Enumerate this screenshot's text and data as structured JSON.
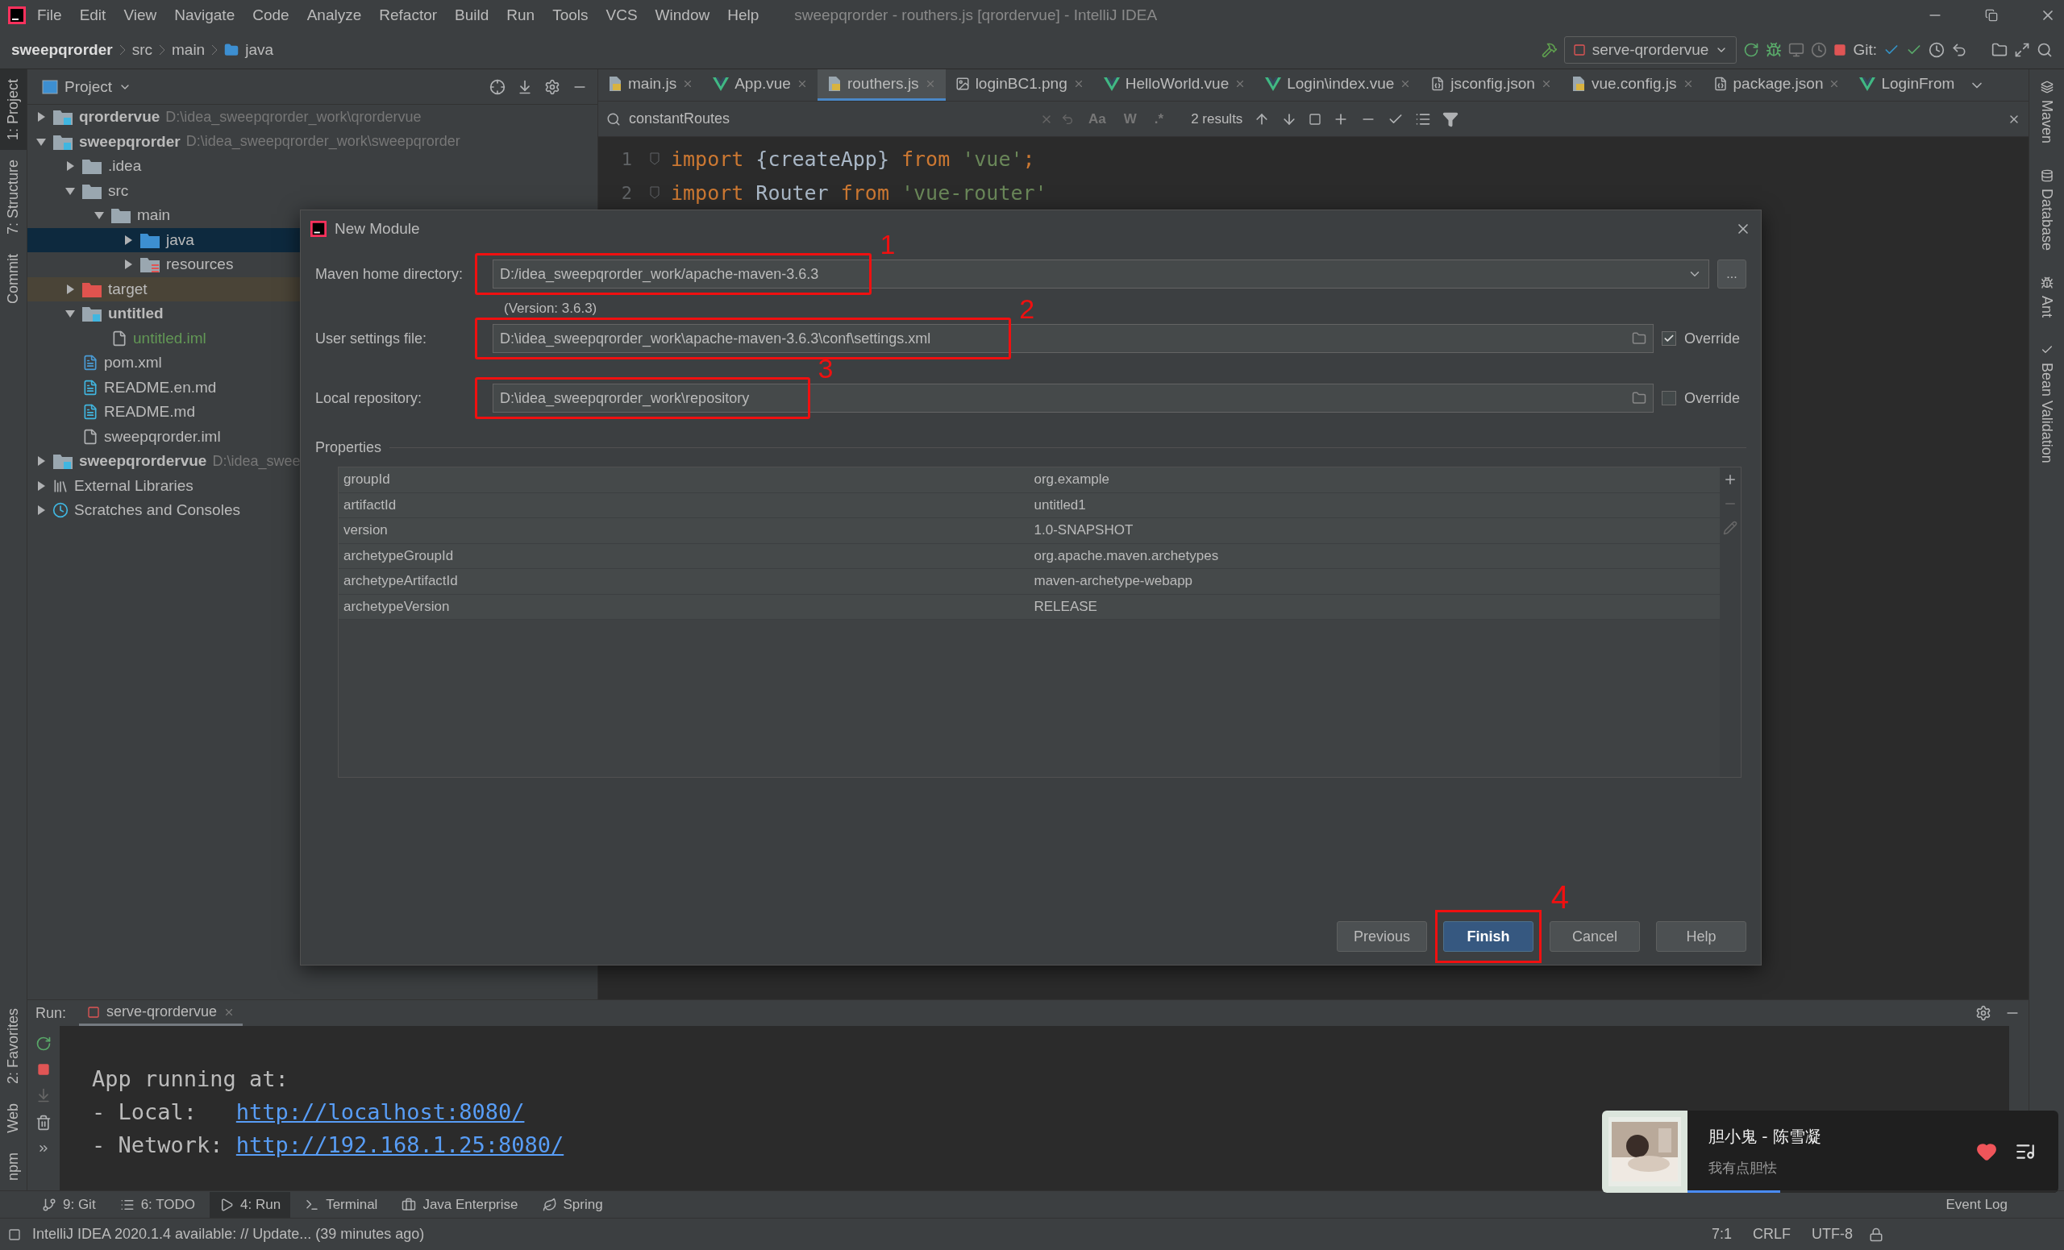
{
  "menu_bar": {
    "items": [
      "File",
      "Edit",
      "View",
      "Navigate",
      "Code",
      "Analyze",
      "Refactor",
      "Build",
      "Run",
      "Tools",
      "VCS",
      "Window",
      "Help"
    ],
    "title": "sweepqrorder - routhers.js [qrordervue] - IntelliJ IDEA"
  },
  "breadcrumbs": [
    "sweepqrorder",
    "src",
    "main",
    "java"
  ],
  "toolbar": {
    "run_config": "serve-qrordervue",
    "git_label": "Git:"
  },
  "left_strip": [
    {
      "label": "1: Project",
      "selected": true
    },
    {
      "label": "7: Structure",
      "selected": false
    },
    {
      "label": "Commit",
      "selected": false
    }
  ],
  "left_strip_bottom": [
    "2: Favorites",
    "Web",
    "npm"
  ],
  "right_strip": [
    "Maven",
    "Database",
    "Ant",
    "Bean Validation"
  ],
  "project_panel": {
    "title": "Project",
    "tree": [
      {
        "name": "qrordervue",
        "path": "D:\\idea_sweepqrorder_work\\qrordervue",
        "kind": "module",
        "expanded": false,
        "selected": false
      },
      {
        "name": "sweepqrorder",
        "path": "D:\\idea_sweepqrorder_work\\sweepqrorder",
        "kind": "module",
        "expanded": true,
        "selected": false,
        "children": [
          {
            "name": ".idea",
            "kind": "folder",
            "expanded": false,
            "selected": false
          },
          {
            "name": "src",
            "kind": "folder",
            "expanded": true,
            "selected": false,
            "children": [
              {
                "name": "main",
                "kind": "folder",
                "expanded": true,
                "selected": false,
                "children": [
                  {
                    "name": "java",
                    "kind": "source-folder",
                    "expanded": false,
                    "selected": true
                  },
                  {
                    "name": "resources",
                    "kind": "resources-folder",
                    "expanded": false,
                    "selected": false
                  }
                ]
              }
            ]
          },
          {
            "name": "target",
            "kind": "excluded-folder",
            "expanded": false,
            "selected": false
          },
          {
            "name": "untitled",
            "kind": "module",
            "expanded": true,
            "selected": false,
            "children": [
              {
                "name": "untitled.iml",
                "kind": "iml",
                "selected": false,
                "added": true
              }
            ]
          },
          {
            "name": "pom.xml",
            "kind": "maven",
            "selected": false
          },
          {
            "name": "README.en.md",
            "kind": "markdown",
            "selected": false
          },
          {
            "name": "README.md",
            "kind": "markdown",
            "selected": false
          },
          {
            "name": "sweepqrorder.iml",
            "kind": "iml",
            "selected": false
          }
        ]
      },
      {
        "name": "sweepqrordervue",
        "path": "D:\\idea_swee",
        "kind": "module",
        "expanded": false,
        "selected": false
      },
      {
        "name": "External Libraries",
        "kind": "libraries",
        "expanded": false,
        "selected": false
      },
      {
        "name": "Scratches and Consoles",
        "kind": "scratches",
        "expanded": false,
        "selected": false
      }
    ]
  },
  "editor": {
    "tabs": [
      {
        "label": "main.js",
        "kind": "js",
        "selected": false
      },
      {
        "label": "App.vue",
        "kind": "vue",
        "selected": false
      },
      {
        "label": "routhers.js",
        "kind": "js",
        "selected": true
      },
      {
        "label": "loginBC1.png",
        "kind": "png",
        "selected": false
      },
      {
        "label": "HelloWorld.vue",
        "kind": "vue",
        "selected": false
      },
      {
        "label": "Login\\index.vue",
        "kind": "vue",
        "selected": false
      },
      {
        "label": "jsconfig.json",
        "kind": "json",
        "selected": false
      },
      {
        "label": "vue.config.js",
        "kind": "js",
        "selected": false
      },
      {
        "label": "package.json",
        "kind": "json",
        "selected": false
      },
      {
        "label": "LoginFrom",
        "kind": "vue",
        "selected": false
      }
    ],
    "find": {
      "query": "constantRoutes",
      "toggles": [
        "Aa",
        "W",
        ".*"
      ],
      "results": "2 results"
    },
    "lines": [
      {
        "number": "1",
        "tokens": [
          {
            "kind": "keyword",
            "text": "import"
          },
          {
            "kind": "plain",
            "text": " {createApp} "
          },
          {
            "kind": "keyword",
            "text": "from"
          },
          {
            "kind": "string",
            "text": " 'vue'"
          },
          {
            "kind": "keyword",
            "text": ";"
          }
        ]
      },
      {
        "number": "2",
        "tokens": [
          {
            "kind": "keyword",
            "text": "import"
          },
          {
            "kind": "plain",
            "text": " Router "
          },
          {
            "kind": "keyword",
            "text": "from"
          },
          {
            "kind": "string",
            "text": " 'vue-router'"
          }
        ]
      }
    ]
  },
  "dialog": {
    "title": "New Module",
    "fields": [
      {
        "label": "Maven home directory:",
        "value": "D:/idea_sweepqrorder_work/apache-maven-3.6.3",
        "kind": "dropdown",
        "annotation": "1"
      },
      {
        "label": "User settings file:",
        "value": "D:\\idea_sweepqrorder_work\\apache-maven-3.6.3\\conf\\settings.xml",
        "kind": "file",
        "override_label": "Override",
        "override": true,
        "annotation": "2"
      },
      {
        "label": "Local repository:",
        "value": "D:\\idea_sweepqrorder_work\\repository",
        "kind": "file",
        "override_label": "Override",
        "override": false,
        "annotation": "3"
      }
    ],
    "version_note": "(Version: 3.6.3)",
    "browse_button": "...",
    "properties_label": "Properties",
    "properties": [
      {
        "key": "groupId",
        "value": "org.example"
      },
      {
        "key": "artifactId",
        "value": "untitled1"
      },
      {
        "key": "version",
        "value": "1.0-SNAPSHOT"
      },
      {
        "key": "archetypeGroupId",
        "value": "org.apache.maven.archetypes"
      },
      {
        "key": "archetypeArtifactId",
        "value": "maven-archetype-webapp"
      },
      {
        "key": "archetypeVersion",
        "value": "RELEASE"
      }
    ],
    "buttons": [
      {
        "label": "Previous",
        "kind": "normal"
      },
      {
        "label": "Finish",
        "kind": "default",
        "annotation": "4"
      },
      {
        "label": "Cancel",
        "kind": "normal"
      },
      {
        "label": "Help",
        "kind": "normal"
      }
    ]
  },
  "run_panel": {
    "label": "Run:",
    "tab": "serve-qrordervue",
    "console": [
      {
        "text": "App running at:"
      },
      {
        "text": "- Local:   ",
        "link": "http://localhost:8080/"
      },
      {
        "text": "- Network: ",
        "link": "http://192.168.1.25:8080/"
      }
    ]
  },
  "tool_tabs": [
    {
      "label": "9: Git",
      "kind": "git",
      "selected": false
    },
    {
      "label": "6: TODO",
      "kind": "todo",
      "selected": false
    },
    {
      "label": "4: Run",
      "kind": "run",
      "selected": true
    },
    {
      "label": "Terminal",
      "kind": "terminal",
      "selected": false
    },
    {
      "label": "Java Enterprise",
      "kind": "enterprise",
      "selected": false
    },
    {
      "label": "Spring",
      "kind": "spring",
      "selected": false
    }
  ],
  "event_log": "Event Log",
  "status_bar": {
    "message": "IntelliJ IDEA 2020.1.4 available: // Update... (39 minutes ago)",
    "items": [
      "7:1",
      "CRLF",
      "UTF-8"
    ]
  },
  "notification": {
    "title": "胆小鬼 - 陈雪凝",
    "subtitle": "我有点胆怯",
    "liked": true,
    "level": 0.25
  }
}
